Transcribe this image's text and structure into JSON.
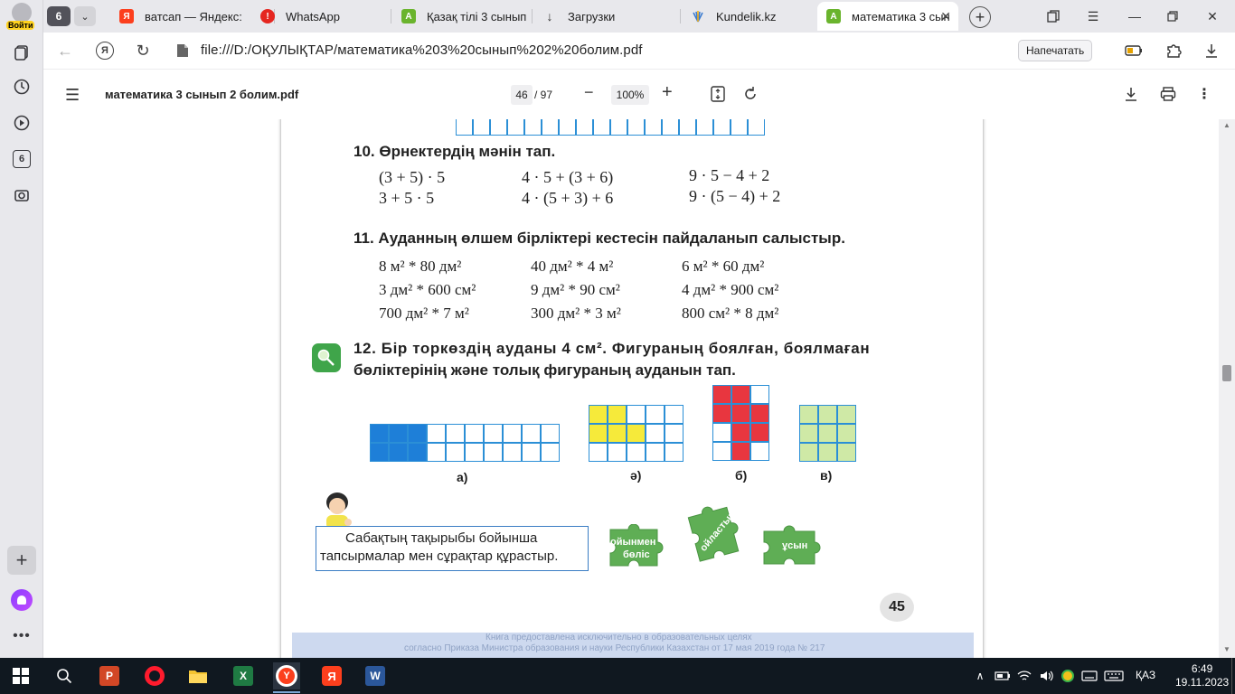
{
  "side_panel": {
    "login_label": "Войти",
    "badge": "6"
  },
  "tabs": {
    "count": "6",
    "items": [
      {
        "label": "ватсап — Яндекс:",
        "fav_color": "#fc3f1d",
        "fav_text": "Я"
      },
      {
        "label": "WhatsApp",
        "fav_color": "#e52620",
        "fav_text": "!"
      },
      {
        "label": "Қазақ тілі 3 сынып",
        "fav_color": "#6ab42d",
        "fav_text": "A"
      },
      {
        "label": "Загрузки",
        "fav_color": "#ffffff",
        "fav_text": "↓"
      },
      {
        "label": "Kundelik.kz",
        "fav_color": "#ffffff",
        "fav_text": ""
      },
      {
        "label": "математика 3 сын",
        "fav_color": "#6ab42d",
        "fav_text": "A"
      }
    ]
  },
  "address": {
    "url": "file:///D:/ОҚУЛЫҚТАР/математика%203%20сынып%202%20болим.pdf",
    "print_label": "Напечатать"
  },
  "pdf_toolbar": {
    "title": "математика 3 сынып 2 болим.pdf",
    "page_current": "46",
    "page_total": "/ 97",
    "zoom": "100%"
  },
  "page": {
    "task10": {
      "heading": "10. Өрнектердің мәнін тап.",
      "col1": [
        "(3 + 5) · 5",
        "3 + 5 · 5"
      ],
      "col2": [
        "4 · 5 + (3 + 6)",
        "4 · (5 + 3) + 6"
      ],
      "col3": [
        "9 · 5 − 4 + 2",
        "9 · (5 − 4) + 2"
      ]
    },
    "task11": {
      "heading": "11. Ауданның өлшем бірліктері кестесін пайдаланып салыстыр.",
      "col1": [
        "8 м² * 80 дм²",
        "3 дм² * 600 см²",
        "700 дм² * 7 м²"
      ],
      "col2": [
        "40 дм² * 4 м²",
        "9 дм² * 90 см²",
        "300 дм² * 3 м²"
      ],
      "col3": [
        "6 м² * 60 дм²",
        "4 дм² * 900 см²",
        "800 см² * 8 дм²"
      ]
    },
    "task12": {
      "line1": "12. Бір торкөздің ауданы 4 см². Фигураның боялған, боялмаған",
      "line2": "бөліктерінің және толық фигураның ауданын тап.",
      "labels": [
        "а)",
        "ә)",
        "б)",
        "в)"
      ]
    },
    "bubble": {
      "line1": "Сабақтың тақырыбы бойынша",
      "line2": "тапсырмалар мен сұрақтар құрастыр."
    },
    "puzzles": {
      "p1_line1": "ойынмен",
      "p1_line2": "бөліс",
      "p2": "ойластыр",
      "p3": "ұсын"
    },
    "page_number": "45",
    "footer_line1": "Книга предоставлена исключительно в образовательных целях",
    "footer_line2": "согласно Приказа Министра образования и науки Республики Казахстан от 17 мая 2019 года № 217"
  },
  "taskbar": {
    "lang": "ҚАЗ",
    "time": "6:49",
    "date": "19.11.2023"
  },
  "colors": {
    "grid_blue": "#2b8fd6",
    "fill_blue": "#1e7fd8",
    "fill_yellow": "#f6ea3a",
    "fill_red": "#e8363f",
    "fill_green": "#cfe9a6",
    "puzzle_green": "#5fae55"
  }
}
